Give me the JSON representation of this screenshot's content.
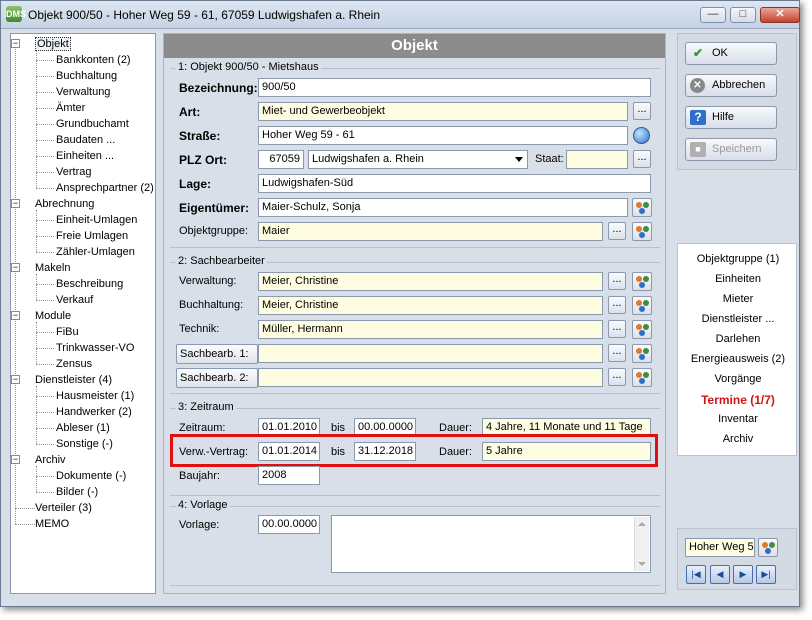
{
  "window": {
    "title": "Objekt 900/50 - Hoher Weg 59 - 61, 67059 Ludwigshafen a. Rhein",
    "icon_text": "DMS"
  },
  "tree": {
    "items": [
      {
        "label": "Objekt",
        "level": 0,
        "selected": true
      },
      {
        "label": "Bankkonten (2)",
        "level": 1
      },
      {
        "label": "Buchhaltung",
        "level": 1
      },
      {
        "label": "Verwaltung",
        "level": 1
      },
      {
        "label": "Ämter",
        "level": 1
      },
      {
        "label": "Grundbuchamt",
        "level": 1
      },
      {
        "label": "Baudaten ...",
        "level": 1
      },
      {
        "label": "Einheiten ...",
        "level": 1
      },
      {
        "label": "Vertrag",
        "level": 1
      },
      {
        "label": "Ansprechpartner (2)",
        "level": 1
      },
      {
        "label": "Abrechnung",
        "level": 0
      },
      {
        "label": "Einheit-Umlagen",
        "level": 1
      },
      {
        "label": "Freie Umlagen",
        "level": 1
      },
      {
        "label": "Zähler-Umlagen",
        "level": 1
      },
      {
        "label": "Makeln",
        "level": 0
      },
      {
        "label": "Beschreibung",
        "level": 1
      },
      {
        "label": "Verkauf",
        "level": 1
      },
      {
        "label": "Module",
        "level": 0
      },
      {
        "label": "FiBu",
        "level": 1
      },
      {
        "label": "Trinkwasser-VO",
        "level": 1
      },
      {
        "label": "Zensus",
        "level": 1
      },
      {
        "label": "Dienstleister (4)",
        "level": 0
      },
      {
        "label": "Hausmeister (1)",
        "level": 1
      },
      {
        "label": "Handwerker (2)",
        "level": 1
      },
      {
        "label": "Ableser (1)",
        "level": 1
      },
      {
        "label": "Sonstige (-)",
        "level": 1
      },
      {
        "label": "Archiv",
        "level": 0
      },
      {
        "label": "Dokumente (-)",
        "level": 1
      },
      {
        "label": "Bilder (-)",
        "level": 1
      },
      {
        "label": "Verteiler (3)",
        "level": 0
      },
      {
        "label": "MEMO",
        "level": 0
      }
    ]
  },
  "main": {
    "header": "Objekt",
    "sec1": {
      "title": "1: Objekt 900/50 - Mietshaus",
      "bezeichnung_label": "Bezeichnung:",
      "bezeichnung": "900/50",
      "art_label": "Art:",
      "art": "Miet- und Gewerbeobjekt",
      "strasse_label": "Straße:",
      "strasse": "Hoher Weg 59 - 61",
      "plz_label": "PLZ Ort:",
      "plz": "67059",
      "ort": "Ludwigshafen a. Rhein",
      "staat_label": "Staat:",
      "staat": "",
      "lage_label": "Lage:",
      "lage": "Ludwigshafen-Süd",
      "eigentuemer_label": "Eigentümer:",
      "eigentuemer": "Maier-Schulz, Sonja",
      "objektgruppe_label": "Objektgruppe:",
      "objektgruppe": "Maier"
    },
    "sec2": {
      "title": "2: Sachbearbeiter",
      "verwaltung_label": "Verwaltung:",
      "verwaltung": "Meier, Christine",
      "buchhaltung_label": "Buchhaltung:",
      "buchhaltung": "Meier, Christine",
      "technik_label": "Technik:",
      "technik": "Müller, Hermann",
      "sb1_label": "Sachbearb. 1:",
      "sb1": "",
      "sb2_label": "Sachbearb. 2:",
      "sb2": ""
    },
    "sec3": {
      "title": "3: Zeitraum",
      "zeitraum_label": "Zeitraum:",
      "zeitraum_von": "01.01.2010",
      "bis_label": "bis",
      "zeitraum_bis": "00.00.0000",
      "dauer_label": "Dauer:",
      "zeitraum_dauer": "4 Jahre, 11 Monate und 11 Tage",
      "verw_label": "Verw.-Vertrag:",
      "verw_von": "01.01.2014",
      "verw_bis": "31.12.2018",
      "verw_dauer": "5 Jahre",
      "baujahr_label": "Baujahr:",
      "baujahr": "2008"
    },
    "sec4": {
      "title": "4: Vorlage",
      "vorlage_label": "Vorlage:",
      "vorlage": "00.00.0000",
      "notes": ""
    },
    "dots_label": "..."
  },
  "buttons": {
    "ok": "OK",
    "abbrechen": "Abbrechen",
    "hilfe": "Hilfe",
    "speichern": "Speichern"
  },
  "right_links": [
    {
      "label": "Objektgruppe (1)",
      "active": false
    },
    {
      "label": "Einheiten",
      "active": false
    },
    {
      "label": "Mieter",
      "active": false
    },
    {
      "label": "Dienstleister ...",
      "active": false
    },
    {
      "label": "Darlehen",
      "active": false
    },
    {
      "label": "Energieausweis (2)",
      "active": false
    },
    {
      "label": "Vorgänge",
      "active": false
    },
    {
      "label": "Termine (1/7)",
      "active": true
    },
    {
      "label": "Inventar",
      "active": false
    },
    {
      "label": "Archiv",
      "active": false
    }
  ],
  "nav": {
    "current": "Hoher Weg 5"
  },
  "colors": {
    "accent_red": "#d01515",
    "header_gray": "#8c8c8c",
    "field_yellow": "#fffde1"
  }
}
